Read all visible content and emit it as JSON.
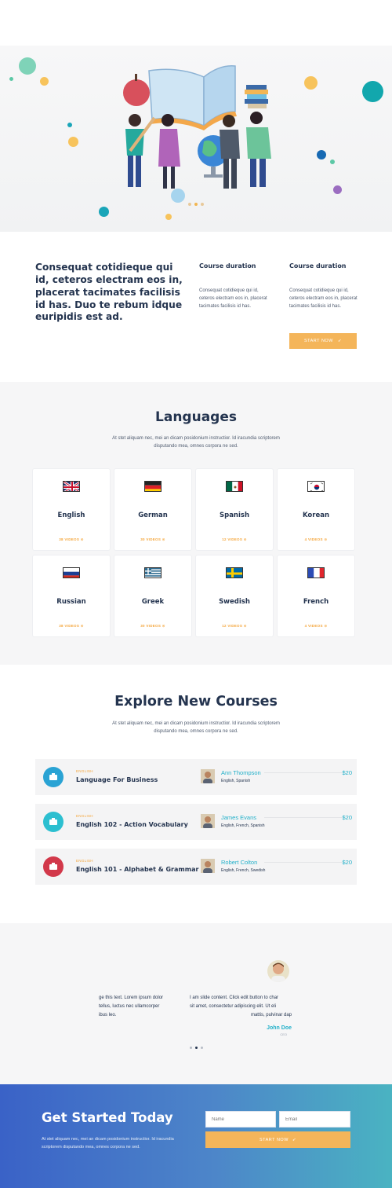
{
  "hero": {
    "slides": 3,
    "active_slide": 2
  },
  "info": {
    "headline": "Consequat cotidieque qui id, ceteros electram eos in, placerat tacimates facilisis id has. Duo te rebum idque euripidis est ad.",
    "columns": [
      {
        "title": "Course duration",
        "text": "Consequat cotidieque qui id, ceteros electram eos in, placerat tacimates facilisis id has."
      },
      {
        "title": "Course duration",
        "text": "Consequat cotidieque qui id, ceteros electram eos in, placerat tacimates facilisis id has."
      }
    ],
    "start_button": "START NOW"
  },
  "languages": {
    "title": "Languages",
    "description": "At stet aliquam nec, mei an dicam posidonium instructior. Id iracundia scriptorem disputando mea, omnes corpora ne sed.",
    "items": [
      {
        "name": "English",
        "videos": "38 VIDEOS",
        "flag": "uk-flag-icon"
      },
      {
        "name": "German",
        "videos": "30 VIDEOS",
        "flag": "germany-flag-icon"
      },
      {
        "name": "Spanish",
        "videos": "12 VIDEOS",
        "flag": "mexico-flag-icon"
      },
      {
        "name": "Korean",
        "videos": "4 VIDEOS",
        "flag": "korea-flag-icon"
      },
      {
        "name": "Russian",
        "videos": "38 VIDEOS",
        "flag": "russia-flag-icon"
      },
      {
        "name": "Greek",
        "videos": "30 VIDEOS",
        "flag": "greece-flag-icon"
      },
      {
        "name": "Swedish",
        "videos": "12 VIDEOS",
        "flag": "sweden-flag-icon"
      },
      {
        "name": "French",
        "videos": "4 VIDEOS",
        "flag": "france-flag-icon"
      }
    ]
  },
  "courses": {
    "title": "Explore New Courses",
    "description": "At stet aliquam nec, mei an dicam posidonium instructior. Id iracundia scriptorem disputando mea, omnes corpora ne sed.",
    "items": [
      {
        "category": "ENGLISH",
        "name": "Language For Business",
        "teacher": "Ann Thompson",
        "languages": "English, Spanish",
        "price": "$20",
        "icon": "briefcase-icon",
        "color": "#2aa3d4"
      },
      {
        "category": "ENGLISH",
        "name": "English 102 - Action Vocabulary",
        "teacher": "James Evans",
        "languages": "English, French, Spanish",
        "price": "$20",
        "icon": "megaphone-icon",
        "color": "#2cbfd0"
      },
      {
        "category": "ENGLISH",
        "name": "English 101 - Alphabet & Grammar",
        "teacher": "Robert Colton",
        "languages": "English, French, Swedish",
        "price": "$20",
        "icon": "apple-icon",
        "color": "#d2384a"
      }
    ]
  },
  "testimonials": {
    "left_text": [
      "ge this text. Lorem ipsum dolor",
      "tellus, luctus nec ullamcorper",
      "ibus leo."
    ],
    "right_text": [
      "I am slide content. Click edit button to char",
      "sit amet, consectetur adipiscing elit. Ut eli",
      "mattis, pulvinar dap"
    ],
    "author": "John Doe",
    "role": "CEO"
  },
  "cta": {
    "title": "Get Started Today",
    "text": "At stet aliquam nec, mei an dicam posidonium instructior. Id iracundia scriptorem disputando mea, omnes corpora ne sed.",
    "name_placeholder": "Name",
    "email_placeholder": "Email",
    "button": "START NOW"
  },
  "colors": {
    "navy": "#24344f",
    "orange": "#f4b55a",
    "teal": "#22b0c9"
  }
}
